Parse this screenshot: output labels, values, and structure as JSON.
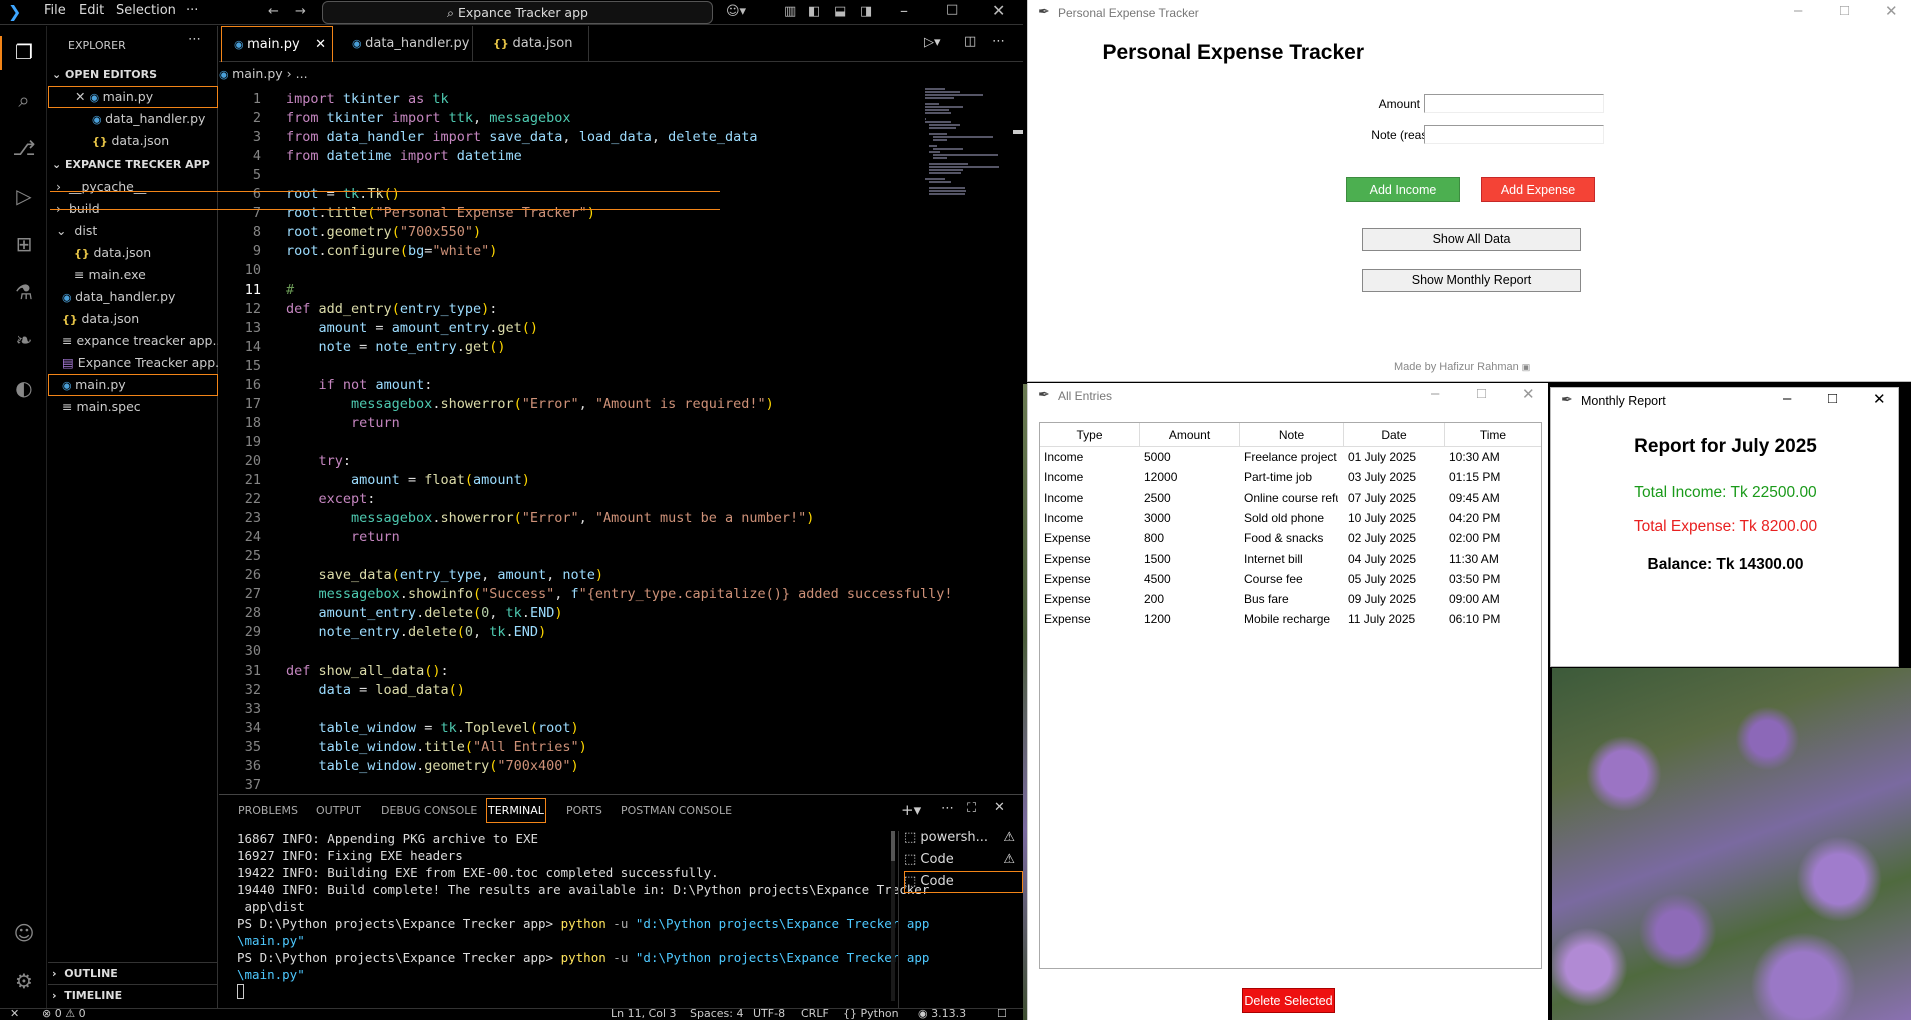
{
  "vscode": {
    "menu": [
      "File",
      "Edit",
      "Selection",
      "···"
    ],
    "command_center": "Expance Tracker app",
    "explorer_title": "EXPLORER",
    "open_editors_label": "OPEN EDITORS",
    "open_editors": [
      "main.py",
      "data_handler.py",
      "data.json"
    ],
    "project_label": "EXPANCE TRECKER APP",
    "files": [
      {
        "name": "__pycache__",
        "kind": "folder",
        "depth": 1
      },
      {
        "name": "build",
        "kind": "folder",
        "depth": 1
      },
      {
        "name": "dist",
        "kind": "folder-open",
        "depth": 1
      },
      {
        "name": "data.json",
        "kind": "json",
        "depth": 2
      },
      {
        "name": "main.exe",
        "kind": "exe",
        "depth": 2
      },
      {
        "name": "data_handler.py",
        "kind": "py",
        "depth": 1
      },
      {
        "name": "data.json",
        "kind": "json",
        "depth": 1
      },
      {
        "name": "expance treacker app...",
        "kind": "spec",
        "depth": 1
      },
      {
        "name": "Expance Treacker app...",
        "kind": "image",
        "depth": 1
      },
      {
        "name": "main.py",
        "kind": "py",
        "depth": 1,
        "selected": true
      },
      {
        "name": "main.spec",
        "kind": "spec",
        "depth": 1
      }
    ],
    "outline_label": "OUTLINE",
    "timeline_label": "TIMELINE",
    "tabs": [
      {
        "label": "main.py",
        "icon": "python-icon",
        "active": true
      },
      {
        "label": "data_handler.py",
        "icon": "python-icon",
        "active": false
      },
      {
        "label": "data.json",
        "icon": "json-icon",
        "active": false
      }
    ],
    "breadcrumb": [
      "main.py",
      "..."
    ],
    "current_line": 11,
    "code_lines": [
      "import tkinter as tk",
      "from tkinter import ttk, messagebox",
      "from data_handler import save_data, load_data, delete_data",
      "from datetime import datetime",
      "",
      "root = tk.Tk()",
      "root.title(\"Personal Expense Tracker\")",
      "root.geometry(\"700x550\")",
      "root.configure(bg=\"white\")",
      "",
      "#",
      "def add_entry(entry_type):",
      "    amount = amount_entry.get()",
      "    note = note_entry.get()",
      "",
      "    if not amount:",
      "        messagebox.showerror(\"Error\", \"Amount is required!\")",
      "        return",
      "",
      "    try:",
      "        amount = float(amount)",
      "    except:",
      "        messagebox.showerror(\"Error\", \"Amount must be a number!\")",
      "        return",
      "",
      "    save_data(entry_type, amount, note)",
      "    messagebox.showinfo(\"Success\", f\"{entry_type.capitalize()} added successfully!",
      "    amount_entry.delete(0, tk.END)",
      "    note_entry.delete(0, tk.END)",
      "",
      "def show_all_data():",
      "    data = load_data()",
      "",
      "    table_window = tk.Toplevel(root)",
      "    table_window.title(\"All Entries\")",
      "    table_window.geometry(\"700x400\")",
      ""
    ],
    "panel_tabs": [
      "PROBLEMS",
      "OUTPUT",
      "DEBUG CONSOLE",
      "TERMINAL",
      "PORTS",
      "POSTMAN CONSOLE"
    ],
    "active_panel_tab": "TERMINAL",
    "terminal_lines": [
      "16867 INFO: Appending PKG archive to EXE",
      "16927 INFO: Fixing EXE headers",
      "19422 INFO: Building EXE from EXE-00.toc completed successfully.",
      "19440 INFO: Build complete! The results are available in: D:\\Python projects\\Expance Trecker",
      " app\\dist"
    ],
    "prompt": "PS D:\\Python projects\\Expance Trecker app>",
    "command": "python",
    "command_flag": "-u",
    "command_path1": "\"d:\\Python projects\\Expance Trecker app",
    "command_path2": "\\main.py\"",
    "terminal_list": [
      "powersh...",
      "Code",
      "Code"
    ],
    "status": {
      "errors": "0",
      "warnings": "0",
      "position": "Ln 11, Col 3",
      "spaces": "Spaces: 4",
      "encoding": "UTF-8",
      "eol": "CRLF",
      "language": "Python",
      "version": "3.13.3"
    }
  },
  "tracker": {
    "window_title": "Personal Expense Tracker",
    "heading": "Personal Expense Tracker",
    "amount_label": "Amount (Tk):",
    "note_label": "Note (reason):",
    "amount_value": "",
    "note_value": "",
    "add_income": "Add Income",
    "add_expense": "Add Expense",
    "show_all": "Show All Data",
    "show_monthly": "Show Monthly Report",
    "footer": "Made by Hafizur Rahman",
    "colors": {
      "income": "#4caf50",
      "expense": "#f44336"
    }
  },
  "entries": {
    "window_title": "All Entries",
    "columns": [
      "Type",
      "Amount",
      "Note",
      "Date",
      "Time"
    ],
    "rows": [
      [
        "Income",
        "5000",
        "Freelance project",
        "01 July 2025",
        "10:30 AM"
      ],
      [
        "Income",
        "12000",
        "Part-time job",
        "03 July 2025",
        "01:15 PM"
      ],
      [
        "Income",
        "2500",
        "Online course refu",
        "07 July 2025",
        "09:45 AM"
      ],
      [
        "Income",
        "3000",
        "Sold old phone",
        "10 July 2025",
        "04:20 PM"
      ],
      [
        "Expense",
        "800",
        "Food & snacks",
        "02 July 2025",
        "02:00 PM"
      ],
      [
        "Expense",
        "1500",
        "Internet bill",
        "04 July 2025",
        "11:30 AM"
      ],
      [
        "Expense",
        "4500",
        "Course fee",
        "05 July 2025",
        "03:50 PM"
      ],
      [
        "Expense",
        "200",
        "Bus fare",
        "09 July 2025",
        "09:00 AM"
      ],
      [
        "Expense",
        "1200",
        "Mobile recharge",
        "11 July 2025",
        "06:10 PM"
      ]
    ],
    "delete_button": "Delete Selected"
  },
  "report": {
    "window_title": "Monthly Report",
    "heading": "Report for July 2025",
    "total_income": "Total Income: Tk 22500.00",
    "total_expense": "Total Expense: Tk 8200.00",
    "balance": "Balance: Tk 14300.00",
    "colors": {
      "income": "#1a9a1a",
      "expense": "#e82020"
    }
  }
}
